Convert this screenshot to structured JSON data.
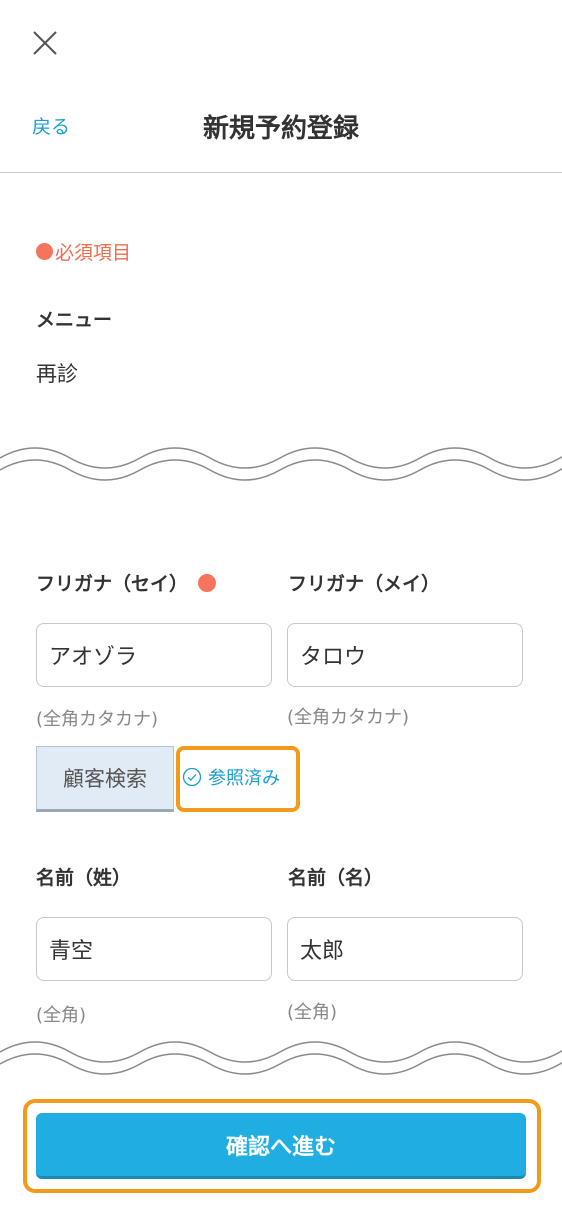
{
  "header": {
    "back_label": "戻る",
    "title": "新規予約登録"
  },
  "form": {
    "required_note": "必須項目",
    "menu": {
      "label": "メニュー",
      "value": "再診"
    },
    "kana_sei": {
      "label": "フリガナ（セイ）",
      "value": "アオゾラ",
      "hint": "(全角カタカナ)"
    },
    "kana_mei": {
      "label": "フリガナ（メイ）",
      "value": "タロウ",
      "hint": "(全角カタカナ)"
    },
    "customer_search_label": "顧客検索",
    "referenced_label": "参照済み",
    "sei": {
      "label": "名前（姓）",
      "value": "青空",
      "hint": "(全角)"
    },
    "mei": {
      "label": "名前（名）",
      "value": "太郎",
      "hint": "(全角)"
    }
  },
  "footer": {
    "confirm_label": "確認へ進む"
  },
  "colors": {
    "accent": "#20ade2",
    "link": "#1a9fd1",
    "required": "#f6745c",
    "highlight": "#f39a1a"
  }
}
